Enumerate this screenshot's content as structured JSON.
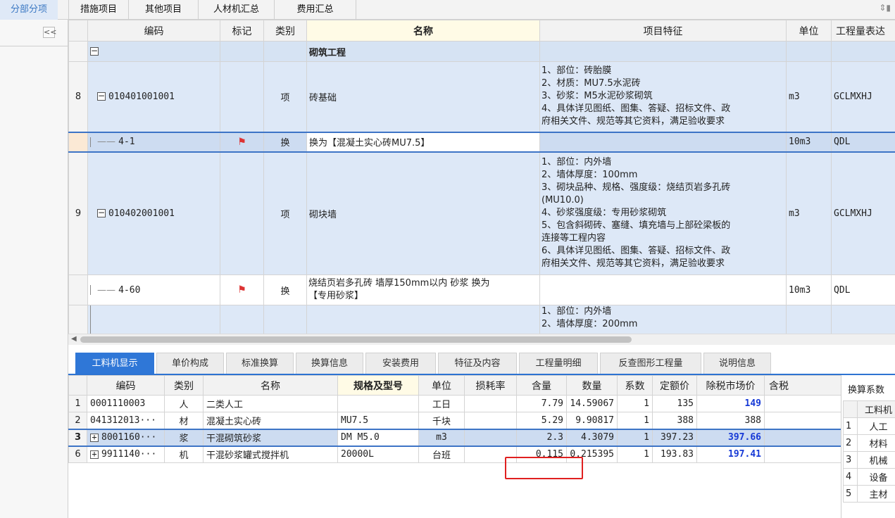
{
  "top_tabs": [
    "分部分项",
    "措施项目",
    "其他项目",
    "人材机汇总",
    "费用汇总"
  ],
  "top_right_icon": "sort-icon",
  "left_panel": {
    "collapse_label": "<<"
  },
  "grid": {
    "headers": [
      "编码",
      "标记",
      "类别",
      "名称",
      "项目特征",
      "单位",
      "工程量表达"
    ],
    "section": {
      "name": "砌筑工程"
    },
    "rows": [
      {
        "no": "8",
        "code": "010401001001",
        "mark": "",
        "type": "项",
        "name": "砖基础",
        "features": [
          "1、部位：砖胎膜",
          "2、材质：MU7.5水泥砖",
          "3、砂浆：M5水泥砂浆砌筑",
          "4、具体详见图纸、图集、答疑、招标文件、政",
          "府相关文件、规范等其它资料，满足验收要求"
        ],
        "unit": "m3",
        "expr": "GCLMXHJ"
      },
      {
        "no": "",
        "code": "4-1",
        "mark": "flag",
        "type": "换",
        "name": "换为【混凝土实心砖MU7.5】",
        "features": [],
        "unit": "10m3",
        "expr": "QDL"
      },
      {
        "no": "9",
        "code": "010402001001",
        "mark": "",
        "type": "项",
        "name": "砌块墙",
        "features": [
          "1、部位：内外墙",
          "2、墙体厚度：100mm",
          "3、砌块品种、规格、强度级：烧结页岩多孔砖",
          "(MU10.0)",
          "4、砂浆强度级：专用砂浆砌筑",
          "5、包含斜砌砖、塞缝、填充墙与上部砼梁板的",
          "连接等工程内容",
          "6、具体详见图纸、图集、答疑、招标文件、政",
          "府相关文件、规范等其它资料，满足验收要求"
        ],
        "unit": "m3",
        "expr": "GCLMXHJ"
      },
      {
        "no": "",
        "code": "4-60",
        "mark": "flag",
        "type": "换",
        "name_lines": [
          "烧结页岩多孔砖 墙厚150mm以内 砂浆  换为",
          "【专用砂浆】"
        ],
        "features": [],
        "unit": "10m3",
        "expr": "QDL"
      },
      {
        "no": "",
        "code": "",
        "mark": "",
        "type": "",
        "name": "",
        "features": [
          "1、部位：内外墙",
          "2、墙体厚度：200mm"
        ],
        "unit": "",
        "expr": ""
      }
    ]
  },
  "bottom_tabs": [
    "工料机显示",
    "单价构成",
    "标准换算",
    "换算信息",
    "安装费用",
    "特征及内容",
    "工程量明细",
    "反查图形工程量",
    "说明信息"
  ],
  "bottom_grid": {
    "headers": [
      "编码",
      "类别",
      "名称",
      "规格及型号",
      "单位",
      "损耗率",
      "含量",
      "数量",
      "系数",
      "定额价",
      "除税市场价",
      "含税"
    ],
    "rows": [
      {
        "no": "1",
        "code": "0001110003",
        "exp": "",
        "cat": "人",
        "name": "二类人工",
        "spec": "",
        "unit": "工日",
        "loss": "",
        "content": "7.79",
        "qty": "14.59067",
        "coef": "1",
        "price": "135",
        "market": "149",
        "market_blue": true
      },
      {
        "no": "2",
        "code": "041312013···",
        "exp": "",
        "cat": "材",
        "name": "混凝土实心砖",
        "spec": "MU7.5",
        "unit": "千块",
        "loss": "",
        "content": "5.29",
        "qty": "9.90817",
        "coef": "1",
        "price": "388",
        "market": "388",
        "market_blue": false
      },
      {
        "no": "3",
        "code": "8001160···",
        "exp": "+",
        "cat": "浆",
        "name": "干混砌筑砂浆",
        "spec": "DM M5.0",
        "unit": "m3",
        "loss": "",
        "content": "2.3",
        "qty": "4.3079",
        "coef": "1",
        "price": "397.23",
        "market": "397.66",
        "market_blue": true
      },
      {
        "no": "6",
        "code": "9911140···",
        "exp": "+",
        "cat": "机",
        "name": "干混砂浆罐式搅拌机",
        "spec": "20000L",
        "unit": "台班",
        "loss": "",
        "content": "0.115",
        "qty": "0.215395",
        "coef": "1",
        "price": "193.83",
        "market": "197.41",
        "market_blue": true
      }
    ]
  },
  "coef_panel": {
    "title": "换算系数",
    "header": "工料机",
    "rows": [
      {
        "no": "1",
        "name": "人工"
      },
      {
        "no": "2",
        "name": "材料"
      },
      {
        "no": "3",
        "name": "机械"
      },
      {
        "no": "4",
        "name": "设备"
      },
      {
        "no": "5",
        "name": "主材"
      }
    ]
  },
  "colors": {
    "accent": "#2f77d7",
    "selection": "#cddcf1",
    "highlight_red": "#e02020",
    "market_blue": "#1639d6"
  }
}
